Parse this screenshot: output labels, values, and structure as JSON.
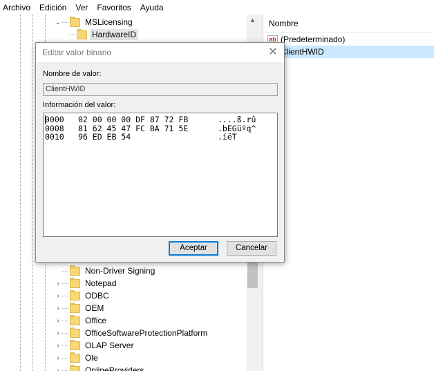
{
  "menu": [
    "Archivo",
    "Edición",
    "Ver",
    "Favoritos",
    "Ayuda"
  ],
  "tree": {
    "top_items": [
      {
        "label": "MSLicensing",
        "expanded": true
      },
      {
        "label": "HardwareID",
        "selected": true
      }
    ],
    "bottom_items": [
      {
        "label": "Non-Driver Signing"
      },
      {
        "label": "Notepad"
      },
      {
        "label": "ODBC"
      },
      {
        "label": "OEM"
      },
      {
        "label": "Office"
      },
      {
        "label": "OfficeSoftwareProtectionPlatform"
      },
      {
        "label": "OLAP Server"
      },
      {
        "label": "Ole"
      },
      {
        "label": "OnlineProviders"
      }
    ]
  },
  "list": {
    "column_header": "Nombre",
    "rows": [
      {
        "label": "(Predeterminado)",
        "icon": "string-value-icon"
      },
      {
        "label": "ClientHWID",
        "icon": "binary-value-icon",
        "selected": true
      }
    ]
  },
  "dialog": {
    "title": "Editar valor binario",
    "value_name_label": "Nombre de valor:",
    "value_name": "ClientHWID",
    "value_data_label": "Información del valor:",
    "hex_rows": [
      {
        "offset": "0000",
        "bytes": "02 00 00 00 DF 87 72 FB",
        "ascii": "....ß.rû"
      },
      {
        "offset": "0008",
        "bytes": "81 62 45 47 FC BA 71 5E",
        "ascii": ".bEGüºq^"
      },
      {
        "offset": "0010",
        "bytes": "96 ED EB 54",
        "ascii": ".íëT"
      }
    ],
    "ok_label": "Aceptar",
    "cancel_label": "Cancelar",
    "close_glyph": "✕"
  }
}
